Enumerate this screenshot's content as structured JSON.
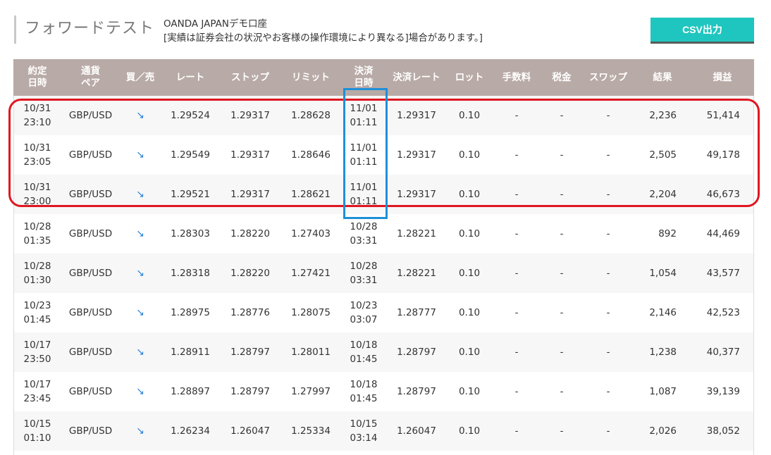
{
  "header": {
    "title": "フォワードテスト",
    "account": "OANDA JAPANデモ口座",
    "disclaimer": "[実績は証券会社の状況やお客様の操作環境により異なる]場合があります。]",
    "csv_button": "CSV出力"
  },
  "table": {
    "columns": [
      [
        "約定",
        "日時"
      ],
      [
        "通貨",
        "ペア"
      ],
      [
        "買／売"
      ],
      [
        "レート"
      ],
      [
        "ストップ"
      ],
      [
        "リミット"
      ],
      [
        "決済",
        "日時"
      ],
      [
        "決済レート"
      ],
      [
        "ロット"
      ],
      [
        "手数料"
      ],
      [
        "税金"
      ],
      [
        "スワップ"
      ],
      [
        "結果"
      ],
      [
        "損益"
      ]
    ],
    "rows": [
      {
        "open_date": "10/31",
        "open_time": "23:10",
        "pair": "GBP/USD",
        "side": "↘",
        "rate": "1.29524",
        "stop": "1.29317",
        "limit": "1.28628",
        "close_date": "11/01",
        "close_time": "01:11",
        "close_rate": "1.29317",
        "lot": "0.10",
        "fee": "-",
        "tax": "-",
        "swap": "-",
        "result": "2,236",
        "pnl": "51,414"
      },
      {
        "open_date": "10/31",
        "open_time": "23:05",
        "pair": "GBP/USD",
        "side": "↘",
        "rate": "1.29549",
        "stop": "1.29317",
        "limit": "1.28646",
        "close_date": "11/01",
        "close_time": "01:11",
        "close_rate": "1.29317",
        "lot": "0.10",
        "fee": "-",
        "tax": "-",
        "swap": "-",
        "result": "2,505",
        "pnl": "49,178"
      },
      {
        "open_date": "10/31",
        "open_time": "23:00",
        "pair": "GBP/USD",
        "side": "↘",
        "rate": "1.29521",
        "stop": "1.29317",
        "limit": "1.28621",
        "close_date": "11/01",
        "close_time": "01:11",
        "close_rate": "1.29317",
        "lot": "0.10",
        "fee": "-",
        "tax": "-",
        "swap": "-",
        "result": "2,204",
        "pnl": "46,673"
      },
      {
        "open_date": "10/28",
        "open_time": "01:35",
        "pair": "GBP/USD",
        "side": "↘",
        "rate": "1.28303",
        "stop": "1.28220",
        "limit": "1.27403",
        "close_date": "10/28",
        "close_time": "03:31",
        "close_rate": "1.28221",
        "lot": "0.10",
        "fee": "-",
        "tax": "-",
        "swap": "-",
        "result": "892",
        "pnl": "44,469"
      },
      {
        "open_date": "10/28",
        "open_time": "01:30",
        "pair": "GBP/USD",
        "side": "↘",
        "rate": "1.28318",
        "stop": "1.28220",
        "limit": "1.27421",
        "close_date": "10/28",
        "close_time": "03:31",
        "close_rate": "1.28221",
        "lot": "0.10",
        "fee": "-",
        "tax": "-",
        "swap": "-",
        "result": "1,054",
        "pnl": "43,577"
      },
      {
        "open_date": "10/23",
        "open_time": "01:45",
        "pair": "GBP/USD",
        "side": "↘",
        "rate": "1.28975",
        "stop": "1.28776",
        "limit": "1.28075",
        "close_date": "10/23",
        "close_time": "03:07",
        "close_rate": "1.28777",
        "lot": "0.10",
        "fee": "-",
        "tax": "-",
        "swap": "-",
        "result": "2,146",
        "pnl": "42,523"
      },
      {
        "open_date": "10/17",
        "open_time": "23:50",
        "pair": "GBP/USD",
        "side": "↘",
        "rate": "1.28911",
        "stop": "1.28797",
        "limit": "1.28011",
        "close_date": "10/18",
        "close_time": "01:45",
        "close_rate": "1.28797",
        "lot": "0.10",
        "fee": "-",
        "tax": "-",
        "swap": "-",
        "result": "1,238",
        "pnl": "40,377"
      },
      {
        "open_date": "10/17",
        "open_time": "23:45",
        "pair": "GBP/USD",
        "side": "↘",
        "rate": "1.28897",
        "stop": "1.28797",
        "limit": "1.27997",
        "close_date": "10/18",
        "close_time": "01:45",
        "close_rate": "1.28797",
        "lot": "0.10",
        "fee": "-",
        "tax": "-",
        "swap": "-",
        "result": "1,087",
        "pnl": "39,139"
      },
      {
        "open_date": "10/15",
        "open_time": "01:10",
        "pair": "GBP/USD",
        "side": "↘",
        "rate": "1.26234",
        "stop": "1.26047",
        "limit": "1.25334",
        "close_date": "10/15",
        "close_time": "03:14",
        "close_rate": "1.26047",
        "lot": "0.10",
        "fee": "-",
        "tax": "-",
        "swap": "-",
        "result": "2,026",
        "pnl": "38,052"
      }
    ]
  },
  "colors": {
    "header_bg": "#b8aaa6",
    "csv_button": "#1fc6bf",
    "highlight_red": "#e01620",
    "highlight_blue": "#1e90d8",
    "arrow": "#2a7fd6"
  }
}
